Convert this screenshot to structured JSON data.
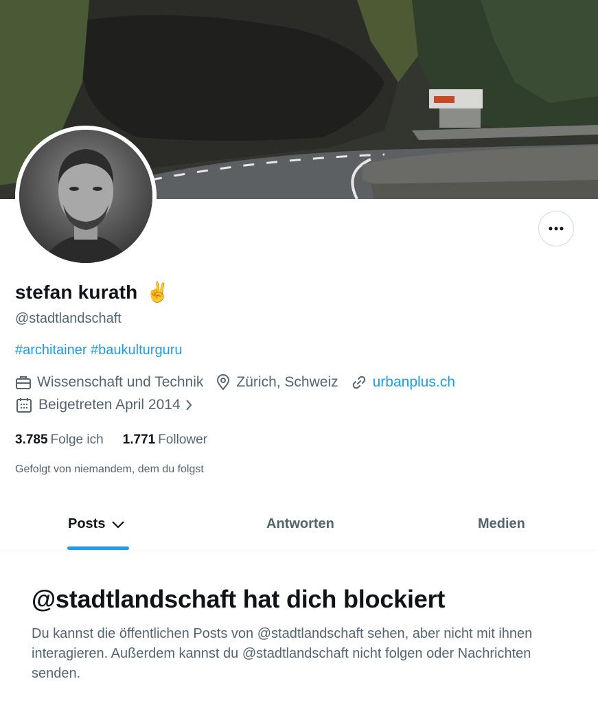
{
  "profile": {
    "name": "stefan kurath",
    "emoji": "✌️",
    "handle": "@stadtlandschaft",
    "bio": "#architainer #baukulturguru"
  },
  "meta": {
    "category": "Wissenschaft und Technik",
    "location": "Zürich, Schweiz",
    "website": "urbanplus.ch",
    "joined": "Beigetreten April 2014"
  },
  "stats": {
    "following_count": "3.785",
    "following_label": "Folge ich",
    "followers_count": "1.771",
    "followers_label": "Follower"
  },
  "followed_by": "Gefolgt von niemandem, dem du folgst",
  "tabs": [
    {
      "label": "Posts",
      "active": true
    },
    {
      "label": "Antworten",
      "active": false
    },
    {
      "label": "Medien",
      "active": false
    }
  ],
  "blocked": {
    "title": "@stadtlandschaft hat dich blockiert",
    "text": "Du kannst die öffentlichen Posts von @stadtlandschaft sehen, aber nicht mit ihnen interagieren. Außerdem kannst du @stadtlandschaft nicht folgen oder Nachrichten senden."
  },
  "colors": {
    "accent": "#1d9bf0",
    "text_primary": "#0f1419",
    "text_secondary": "#536471"
  },
  "icons": [
    "more-icon",
    "briefcase-icon",
    "location-pin-icon",
    "link-icon",
    "calendar-icon",
    "chevron-right-icon",
    "chevron-down-icon"
  ]
}
